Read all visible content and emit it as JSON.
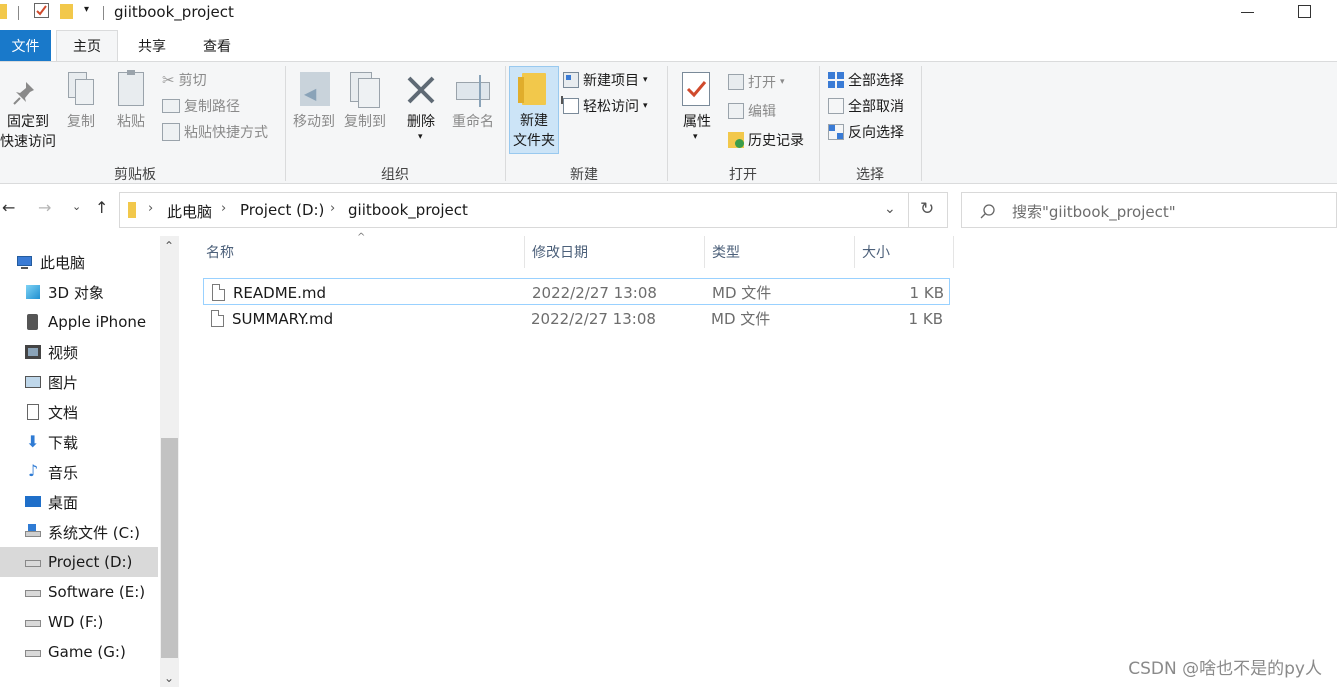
{
  "window": {
    "title": "giitbook_project"
  },
  "ribbon_tabs": [
    {
      "label": "文件",
      "active": false,
      "file_tab": true
    },
    {
      "label": "主页",
      "active": true
    },
    {
      "label": "共享",
      "active": false
    },
    {
      "label": "查看",
      "active": false
    }
  ],
  "ribbon": {
    "clipboard": {
      "group_label": "剪贴板",
      "pin_label_line1": "固定到",
      "pin_label_line2": "快速访问",
      "copy_label": "复制",
      "paste_label": "粘贴",
      "cut_label": "剪切",
      "copy_path_label": "复制路径",
      "paste_shortcut_label": "粘贴快捷方式"
    },
    "organize": {
      "group_label": "组织",
      "move_to_label": "移动到",
      "copy_to_label": "复制到",
      "delete_label": "删除",
      "rename_label": "重命名"
    },
    "new": {
      "group_label": "新建",
      "new_folder_line1": "新建",
      "new_folder_line2": "文件夹",
      "new_item_label": "新建项目",
      "easy_access_label": "轻松访问"
    },
    "open": {
      "group_label": "打开",
      "properties_label": "属性",
      "open_label": "打开",
      "edit_label": "编辑",
      "history_label": "历史记录"
    },
    "select": {
      "group_label": "选择",
      "select_all_label": "全部选择",
      "select_none_label": "全部取消",
      "invert_label": "反向选择"
    }
  },
  "address": {
    "breadcrumb": [
      "此电脑",
      "Project (D:)",
      "giitbook_project"
    ],
    "search_placeholder": "搜索\"giitbook_project\""
  },
  "nav_pane": {
    "items": [
      {
        "label": "此电脑",
        "icon": "computer-icon",
        "indent": 0,
        "selected": false
      },
      {
        "label": "3D 对象",
        "icon": "3d-objects-icon",
        "indent": 1,
        "selected": false
      },
      {
        "label": "Apple iPhone",
        "icon": "phone-icon",
        "indent": 1,
        "selected": false
      },
      {
        "label": "视频",
        "icon": "video-icon",
        "indent": 1,
        "selected": false
      },
      {
        "label": "图片",
        "icon": "pictures-icon",
        "indent": 1,
        "selected": false
      },
      {
        "label": "文档",
        "icon": "documents-icon",
        "indent": 1,
        "selected": false
      },
      {
        "label": "下载",
        "icon": "download-icon",
        "indent": 1,
        "selected": false
      },
      {
        "label": "音乐",
        "icon": "music-icon",
        "indent": 1,
        "selected": false
      },
      {
        "label": "桌面",
        "icon": "desktop-icon",
        "indent": 1,
        "selected": false
      },
      {
        "label": "系统文件 (C:)",
        "icon": "windows-drive-icon",
        "indent": 1,
        "selected": false
      },
      {
        "label": "Project (D:)",
        "icon": "drive-icon",
        "indent": 1,
        "selected": true
      },
      {
        "label": "Software (E:)",
        "icon": "drive-icon",
        "indent": 1,
        "selected": false
      },
      {
        "label": "WD (F:)",
        "icon": "drive-icon",
        "indent": 1,
        "selected": false
      },
      {
        "label": "Game (G:)",
        "icon": "drive-icon",
        "indent": 1,
        "selected": false
      }
    ]
  },
  "file_list": {
    "columns": [
      "名称",
      "修改日期",
      "类型",
      "大小"
    ],
    "rows": [
      {
        "name": "README.md",
        "modified": "2022/2/27 13:08",
        "type": "MD 文件",
        "size": "1 KB",
        "highlighted": true
      },
      {
        "name": "SUMMARY.md",
        "modified": "2022/2/27 13:08",
        "type": "MD 文件",
        "size": "1 KB",
        "highlighted": false
      }
    ]
  },
  "watermark": "CSDN @啥也不是的py人",
  "colors": {
    "accent": "#1979ca",
    "selection_border": "#99d1ff",
    "nav_selected": "#d9d9d9"
  }
}
